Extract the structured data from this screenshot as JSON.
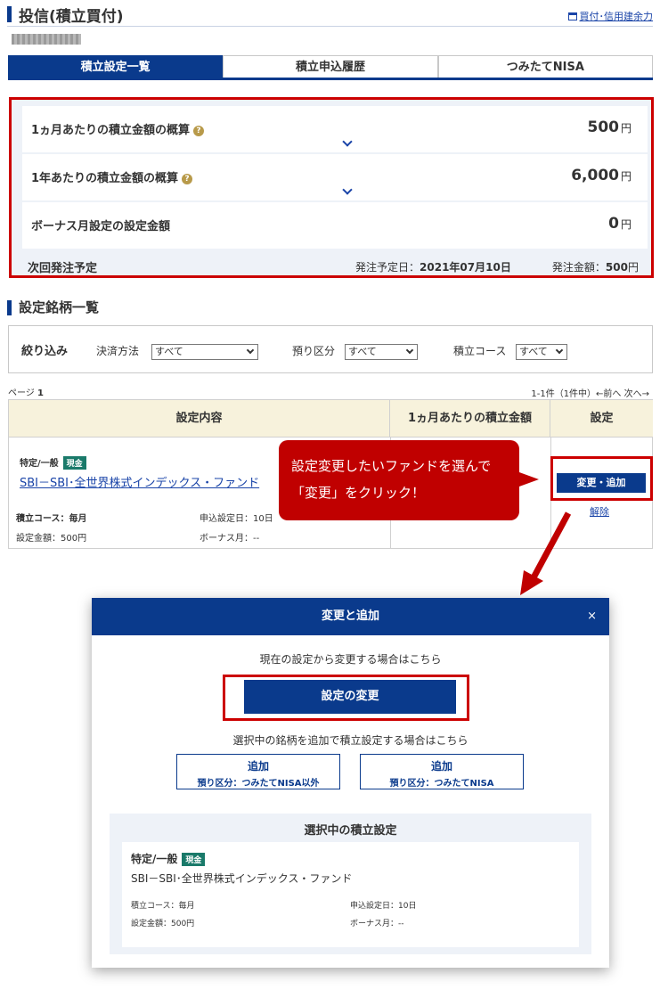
{
  "header": {
    "title": "投信(積立買付)",
    "link": "買付･信用建余力"
  },
  "tabs": [
    {
      "label": "積立設定一覧",
      "active": true
    },
    {
      "label": "積立申込履歴",
      "active": false
    },
    {
      "label": "つみたてNISA",
      "active": false
    }
  ],
  "summary": {
    "monthly": {
      "label": "1ヵ月あたりの積立金額の概算",
      "value": "500",
      "unit": "円"
    },
    "yearly": {
      "label": "1年あたりの積立金額の概算",
      "value": "6,000",
      "unit": "円"
    },
    "bonus": {
      "label": "ボーナス月設定の設定金額",
      "value": "0",
      "unit": "円"
    },
    "next": {
      "label": "次回発注予定",
      "date_label": "発注予定日：",
      "date_value": "2021年07月10日",
      "amount_label": "発注金額：",
      "amount_value": "500",
      "amount_unit": "円"
    }
  },
  "section_title": "設定銘柄一覧",
  "filter": {
    "title": "絞り込み",
    "payment_label": "決済方法",
    "payment_value": "すべて",
    "custody_label": "預り区分",
    "custody_value": "すべて",
    "course_label": "積立コース",
    "course_value": "すべて"
  },
  "paging": {
    "page_label": "ページ",
    "page_value": "1",
    "range": "1-1件（1件中）←前へ 次へ→"
  },
  "table": {
    "headers": [
      "設定内容",
      "1ヵ月あたりの積立金額",
      "設定"
    ],
    "row": {
      "account": "特定/一般",
      "badge": "現金",
      "fund": "SBI－SBI･全世界株式インデックス・ファンド",
      "course": "積立コース：毎月",
      "apply_day": "申込設定日：10日",
      "amount": "設定金額：500円",
      "bonus": "ボーナス月：--",
      "change_button": "変更・追加",
      "delete_link": "解除"
    }
  },
  "callout": {
    "line1": "設定変更したいファンドを選んで",
    "line2": "「変更」をクリック！"
  },
  "modal": {
    "title": "変更と追加",
    "close": "×",
    "change_text": "現在の設定から変更する場合はこちら",
    "change_button": "設定の変更",
    "add_text": "選択中の銘柄を追加で積立設定する場合はこちら",
    "add_button1_title": "追加",
    "add_button1_sub": "預り区分：つみたてNISA以外",
    "add_button2_title": "追加",
    "add_button2_sub": "預り区分：つみたてNISA",
    "selected_title": "選択中の積立設定",
    "account": "特定/一般",
    "badge": "現金",
    "fund": "SBI－SBI･全世界株式インデックス・ファンド",
    "course": "積立コース：毎月",
    "apply_day": "申込設定日：10日",
    "amount": "設定金額：500円",
    "bonus": "ボーナス月：--"
  },
  "colors": {
    "primary": "#0a3a8c",
    "highlight": "#cc0000",
    "badge": "#1a7a6a",
    "header_bg": "#f7f2dc"
  }
}
